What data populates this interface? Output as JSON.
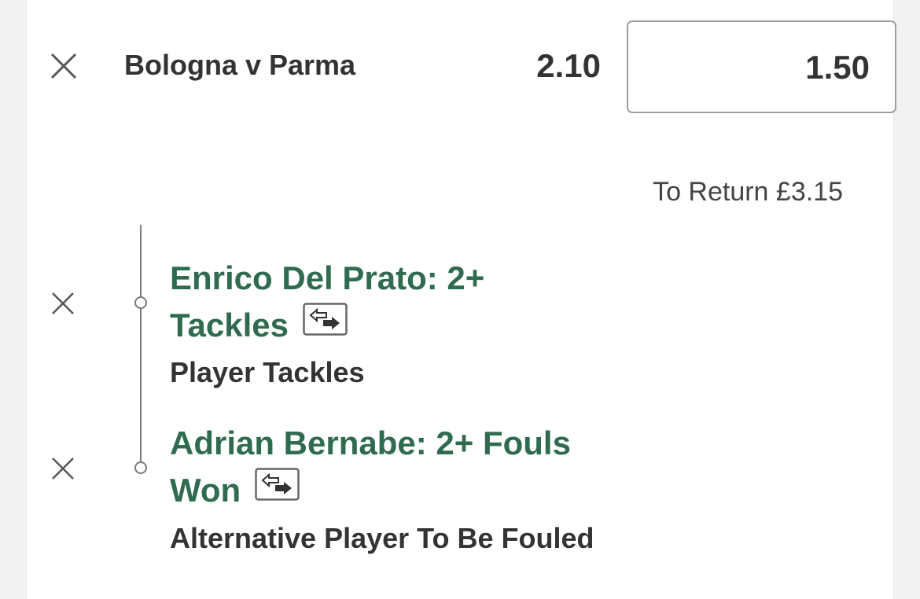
{
  "bet": {
    "match_title": "Bologna v Parma",
    "odds": "2.10",
    "stake": "1.50",
    "to_return": "To Return £3.15"
  },
  "selections": [
    {
      "name_line1": "Enrico Del Prato: 2+",
      "name_line2": "Tackles",
      "market": "Player Tackles"
    },
    {
      "name_line1": "Adrian Bernabe: 2+ Fouls",
      "name_line2": "Won",
      "market": "Alternative Player To Be Fouled"
    }
  ],
  "colors": {
    "selection_green": "#2f6b4f",
    "text_dark": "#333333",
    "border_grey": "#9e9e9e"
  },
  "icons": {
    "remove": "close-icon",
    "swap": "swap-arrows-icon"
  }
}
